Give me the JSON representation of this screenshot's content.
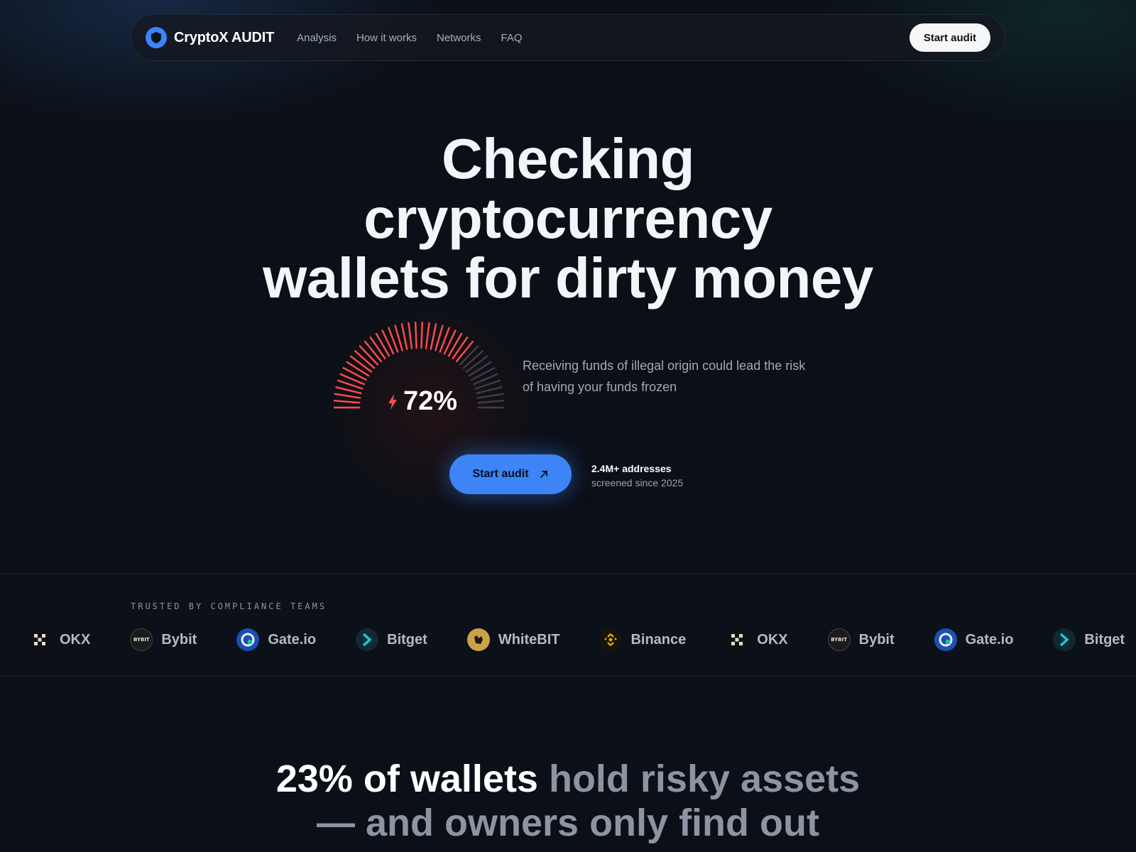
{
  "nav": {
    "brand": "CryptoX AUDIT",
    "links": [
      "Analysis",
      "How it works",
      "Networks",
      "FAQ"
    ],
    "cta": "Start audit"
  },
  "hero": {
    "title_lines": [
      "Checking",
      "cryptocurrency",
      "wallets for dirty money"
    ],
    "gauge_value": "72%",
    "gauge_fraction": 0.72,
    "description": "Receiving funds of illegal origin could lead the risk of having your funds frozen",
    "cta": "Start audit",
    "stat_top": "2.4M+ addresses",
    "stat_sub": "screened since 2025"
  },
  "trust": {
    "label": "TRUSTED BY COMPLIANCE TEAMS",
    "logos": [
      "OKX",
      "Bybit",
      "Gate.io",
      "Bitget",
      "WhiteBIT",
      "Binance",
      "OKX",
      "Bybit",
      "Gate.io",
      "Bitget"
    ]
  },
  "stats_section": {
    "highlight": "23% of wallets",
    "rest_line1": " hold risky assets",
    "line2": "— and owners only find out"
  },
  "colors": {
    "accent": "#3d84f7",
    "gauge_active": "#ff4d4d",
    "gauge_inactive": "#3a3f49",
    "background": "#0b0f17"
  }
}
